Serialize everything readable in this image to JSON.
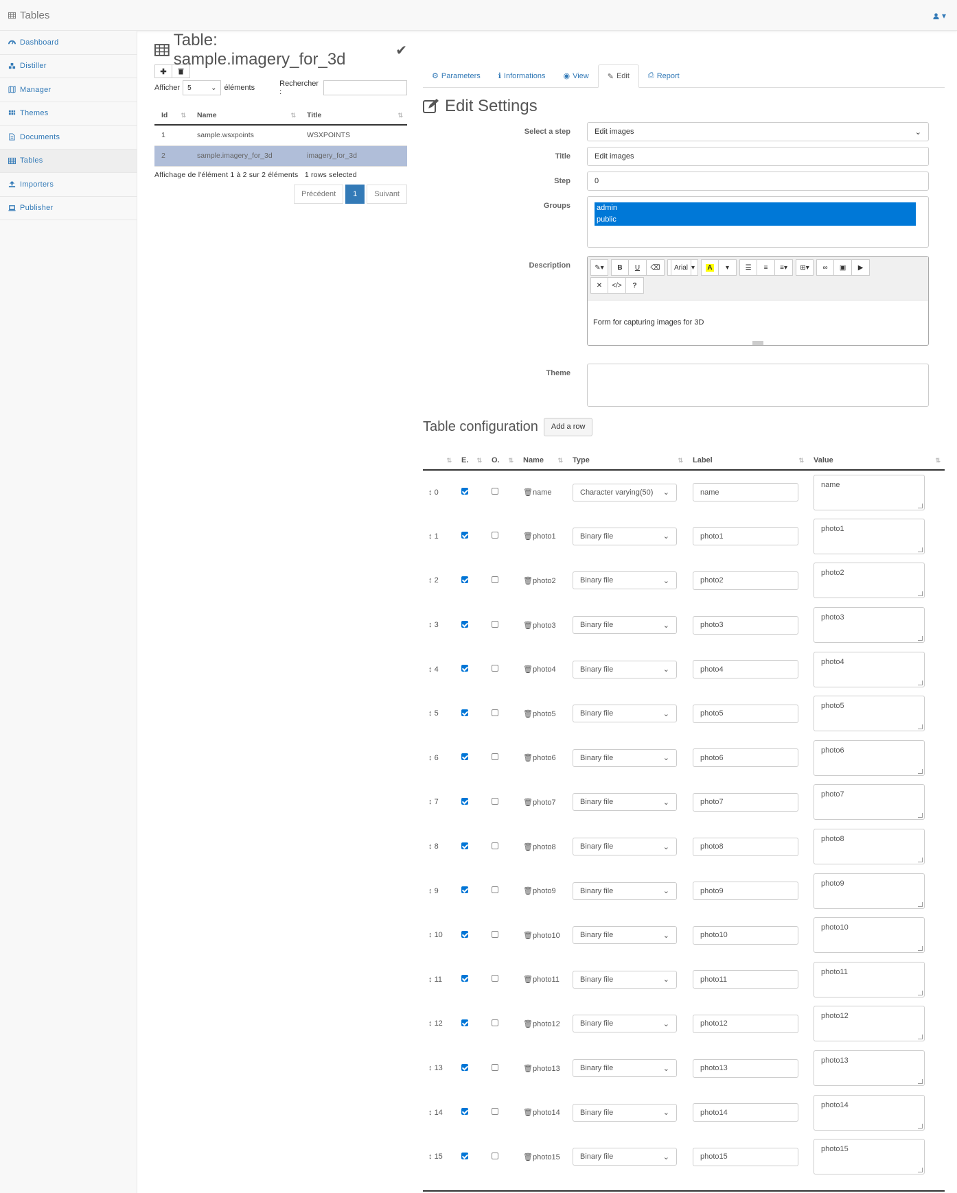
{
  "topbar": {
    "brand": "Tables",
    "brand_icon": "table-icon",
    "user_icon": "user-icon"
  },
  "sidebar": {
    "items": [
      {
        "label": "Dashboard",
        "icon": "dashboard-icon"
      },
      {
        "label": "Distiller",
        "icon": "cubes-icon"
      },
      {
        "label": "Manager",
        "icon": "map-icon"
      },
      {
        "label": "Themes",
        "icon": "grid-icon"
      },
      {
        "label": "Documents",
        "icon": "file-icon"
      },
      {
        "label": "Tables",
        "icon": "table-icon",
        "active": true
      },
      {
        "label": "Importers",
        "icon": "upload-icon"
      },
      {
        "label": "Publisher",
        "icon": "laptop-icon"
      }
    ]
  },
  "left": {
    "title": "Table: sample.imagery_for_3d",
    "show_label": "Afficher",
    "show_value": "5",
    "elements_label": "éléments",
    "search_label": "Rechercher :",
    "columns": [
      "Id",
      "Name",
      "Title"
    ],
    "rows": [
      {
        "id": "1",
        "name": "sample.wsxpoints",
        "title": "WSXPOINTS",
        "selected": false
      },
      {
        "id": "2",
        "name": "sample.imagery_for_3d",
        "title": "imagery_for_3d",
        "selected": true
      }
    ],
    "info": "Affichage de l'élément 1 à 2 sur 2 éléments",
    "selected_info": "1 rows selected",
    "pager": {
      "prev": "Précédent",
      "page": "1",
      "next": "Suivant"
    }
  },
  "tabs": [
    {
      "label": "Parameters",
      "icon": "gear-icon"
    },
    {
      "label": "Informations",
      "icon": "info-icon"
    },
    {
      "label": "View",
      "icon": "eye-icon"
    },
    {
      "label": "Edit",
      "icon": "edit-icon",
      "active": true
    },
    {
      "label": "Report",
      "icon": "print-icon"
    }
  ],
  "edit": {
    "heading": "Edit Settings",
    "step_select_label": "Select a step",
    "step_select_value": "Edit images",
    "title_label": "Title",
    "title_value": "Edit images",
    "step_label": "Step",
    "step_value": "0",
    "groups_label": "Groups",
    "groups": [
      "admin",
      "public"
    ],
    "description_label": "Description",
    "description_value": "Form for capturing images for 3D",
    "font_label": "Arial",
    "theme_label": "Theme"
  },
  "table_config": {
    "title": "Table configuration",
    "add_row": "Add a row",
    "columns": [
      "",
      "E.",
      "O.",
      "Name",
      "Type",
      "Label",
      "Value"
    ],
    "rows": [
      {
        "idx": "0",
        "e": true,
        "o": false,
        "name": "name",
        "type": "Character varying(50)",
        "label": "name",
        "value": "name"
      },
      {
        "idx": "1",
        "e": true,
        "o": false,
        "name": "photo1",
        "type": "Binary file",
        "label": "photo1",
        "value": "photo1"
      },
      {
        "idx": "2",
        "e": true,
        "o": false,
        "name": "photo2",
        "type": "Binary file",
        "label": "photo2",
        "value": "photo2"
      },
      {
        "idx": "3",
        "e": true,
        "o": false,
        "name": "photo3",
        "type": "Binary file",
        "label": "photo3",
        "value": "photo3"
      },
      {
        "idx": "4",
        "e": true,
        "o": false,
        "name": "photo4",
        "type": "Binary file",
        "label": "photo4",
        "value": "photo4"
      },
      {
        "idx": "5",
        "e": true,
        "o": false,
        "name": "photo5",
        "type": "Binary file",
        "label": "photo5",
        "value": "photo5"
      },
      {
        "idx": "6",
        "e": true,
        "o": false,
        "name": "photo6",
        "type": "Binary file",
        "label": "photo6",
        "value": "photo6"
      },
      {
        "idx": "7",
        "e": true,
        "o": false,
        "name": "photo7",
        "type": "Binary file",
        "label": "photo7",
        "value": "photo7"
      },
      {
        "idx": "8",
        "e": true,
        "o": false,
        "name": "photo8",
        "type": "Binary file",
        "label": "photo8",
        "value": "photo8"
      },
      {
        "idx": "9",
        "e": true,
        "o": false,
        "name": "photo9",
        "type": "Binary file",
        "label": "photo9",
        "value": "photo9"
      },
      {
        "idx": "10",
        "e": true,
        "o": false,
        "name": "photo10",
        "type": "Binary file",
        "label": "photo10",
        "value": "photo10"
      },
      {
        "idx": "11",
        "e": true,
        "o": false,
        "name": "photo11",
        "type": "Binary file",
        "label": "photo11",
        "value": "photo11"
      },
      {
        "idx": "12",
        "e": true,
        "o": false,
        "name": "photo12",
        "type": "Binary file",
        "label": "photo12",
        "value": "photo12"
      },
      {
        "idx": "13",
        "e": true,
        "o": false,
        "name": "photo13",
        "type": "Binary file",
        "label": "photo13",
        "value": "photo13"
      },
      {
        "idx": "14",
        "e": true,
        "o": false,
        "name": "photo14",
        "type": "Binary file",
        "label": "photo14",
        "value": "photo14"
      },
      {
        "idx": "15",
        "e": true,
        "o": false,
        "name": "photo15",
        "type": "Binary file",
        "label": "photo15",
        "value": "photo15"
      }
    ]
  }
}
